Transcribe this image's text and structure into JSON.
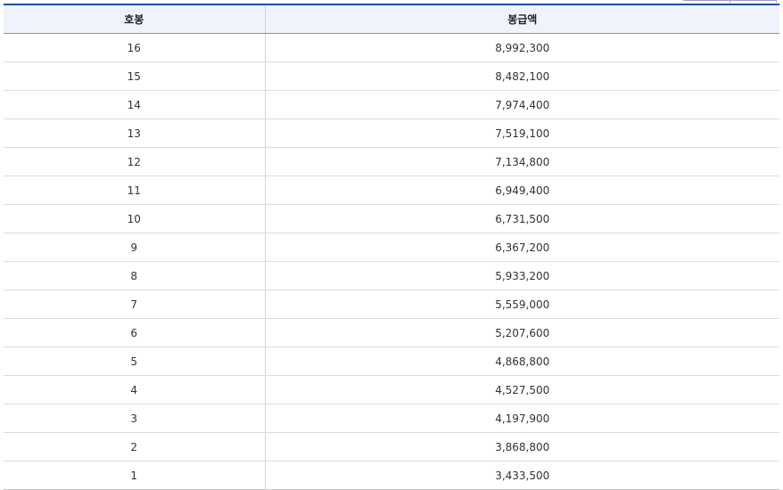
{
  "table": {
    "headers": [
      "호봉",
      "봉급액"
    ],
    "rows": [
      {
        "step": "16",
        "amount": "8,992,300"
      },
      {
        "step": "15",
        "amount": "8,482,100"
      },
      {
        "step": "14",
        "amount": "7,974,400"
      },
      {
        "step": "13",
        "amount": "7,519,100"
      },
      {
        "step": "12",
        "amount": "7,134,800"
      },
      {
        "step": "11",
        "amount": "6,949,400"
      },
      {
        "step": "10",
        "amount": "6,731,500"
      },
      {
        "step": "9",
        "amount": "6,367,200"
      },
      {
        "step": "8",
        "amount": "5,933,200"
      },
      {
        "step": "7",
        "amount": "5,559,000"
      },
      {
        "step": "6",
        "amount": "5,207,600"
      },
      {
        "step": "5",
        "amount": "4,868,800"
      },
      {
        "step": "4",
        "amount": "4,527,500"
      },
      {
        "step": "3",
        "amount": "4,197,900"
      },
      {
        "step": "2",
        "amount": "3,868,800"
      },
      {
        "step": "1",
        "amount": "3,433,500"
      }
    ]
  },
  "colors": {
    "header_background": "#eef3fc",
    "top_border": "#1f4da0"
  }
}
